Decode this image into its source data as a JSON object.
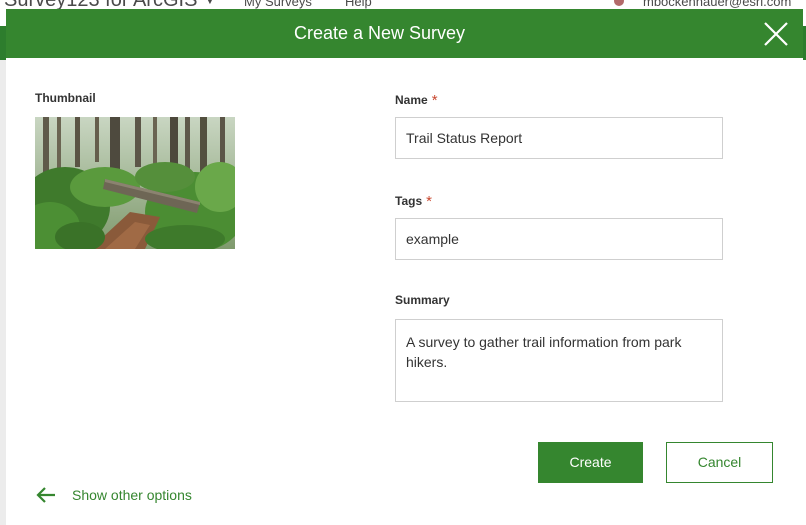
{
  "background_app": {
    "title": "Survey123 for ArcGIS",
    "nav": [
      "My Surveys",
      "Help"
    ],
    "user": "mbockenhauer@esri.com"
  },
  "dialog": {
    "title": "Create a New Survey",
    "thumbnail_label": "Thumbnail",
    "fields": {
      "name": {
        "label": "Name",
        "required_mark": "*",
        "value": "Trail Status Report"
      },
      "tags": {
        "label": "Tags",
        "required_mark": "*",
        "value": "example"
      },
      "summary": {
        "label": "Summary",
        "value": "A survey to gather trail information from park hikers."
      }
    },
    "buttons": {
      "create": "Create",
      "cancel": "Cancel"
    },
    "show_other_options": "Show other options"
  },
  "colors": {
    "brand_green": "#35862f",
    "required_red": "#c8472e"
  },
  "icons": {
    "close": "close-icon",
    "back_arrow": "arrow-left-icon",
    "dropdown": "chevron-down-icon"
  }
}
